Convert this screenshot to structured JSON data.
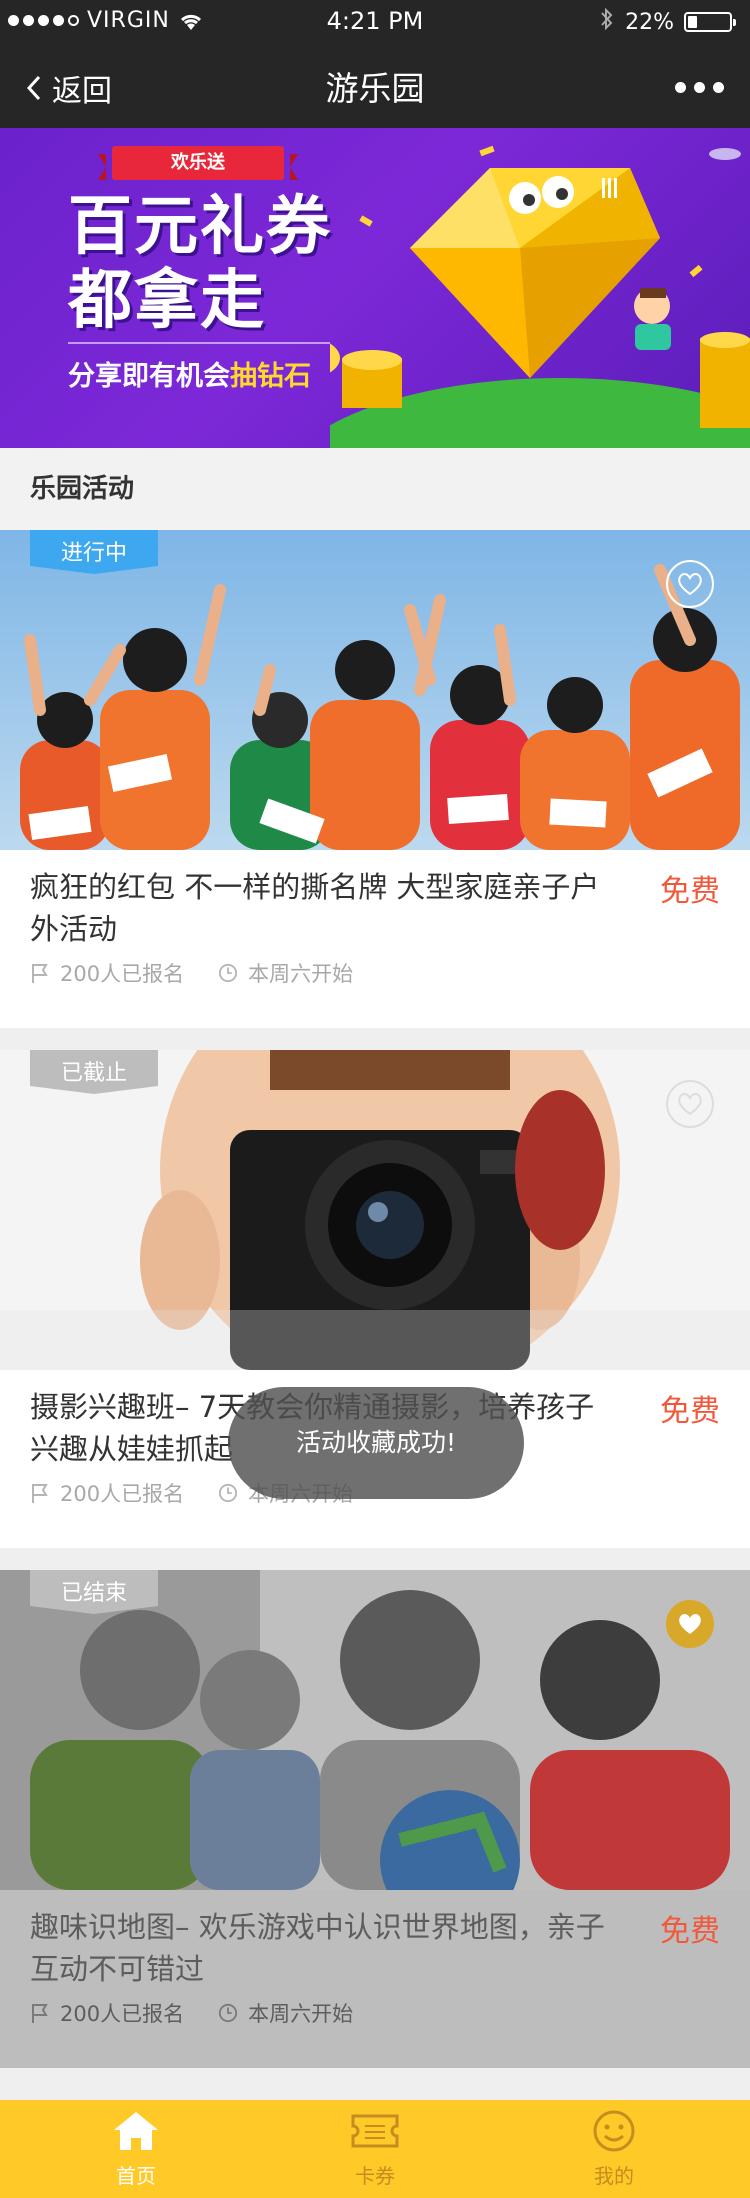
{
  "status_bar": {
    "carrier": "VIRGIN",
    "time": "4:21 PM",
    "battery_percent": "22%",
    "battery_level": 0.22
  },
  "nav": {
    "back_label": "返回",
    "title": "游乐园"
  },
  "banner": {
    "tag": "欢乐送",
    "headline_line1": "百元礼券",
    "headline_line2": "都拿走",
    "sub_prefix": "分享即有机会",
    "sub_highlight": "抽钻石",
    "slide_count": 5,
    "active_slide": 3
  },
  "section": {
    "title": "乐园活动"
  },
  "cards": [
    {
      "status": "进行中",
      "title": "疯狂的红包 不一样的撕名牌 大型家庭亲子户外活动",
      "price": "免费",
      "signups": "200人已报名",
      "start": "本周六开始",
      "favorited": false
    },
    {
      "status": "已截止",
      "title": "摄影兴趣班– 7天教会你精通摄影，培养孩子兴趣从娃娃抓起",
      "price": "免费",
      "signups": "200人已报名",
      "start": "本周六开始",
      "favorited": false
    },
    {
      "status": "已结束",
      "title": "趣味识地图– 欢乐游戏中认识世界地图，亲子互动不可错过",
      "price": "免费",
      "signups": "200人已报名",
      "start": "本周六开始",
      "favorited": true
    }
  ],
  "toast": {
    "message": "活动收藏成功!"
  },
  "tabs": [
    {
      "label": "首页",
      "icon": "home-icon",
      "active": true
    },
    {
      "label": "卡券",
      "icon": "ticket-icon",
      "active": false
    },
    {
      "label": "我的",
      "icon": "smiley-icon",
      "active": false
    }
  ],
  "colors": {
    "nav_bg": "#262626",
    "accent": "#ffc927",
    "price": "#f2583a",
    "badge_active": "#3da8f0",
    "badge_inactive": "#bdbdbd",
    "banner_bg": "#6a22cc"
  }
}
